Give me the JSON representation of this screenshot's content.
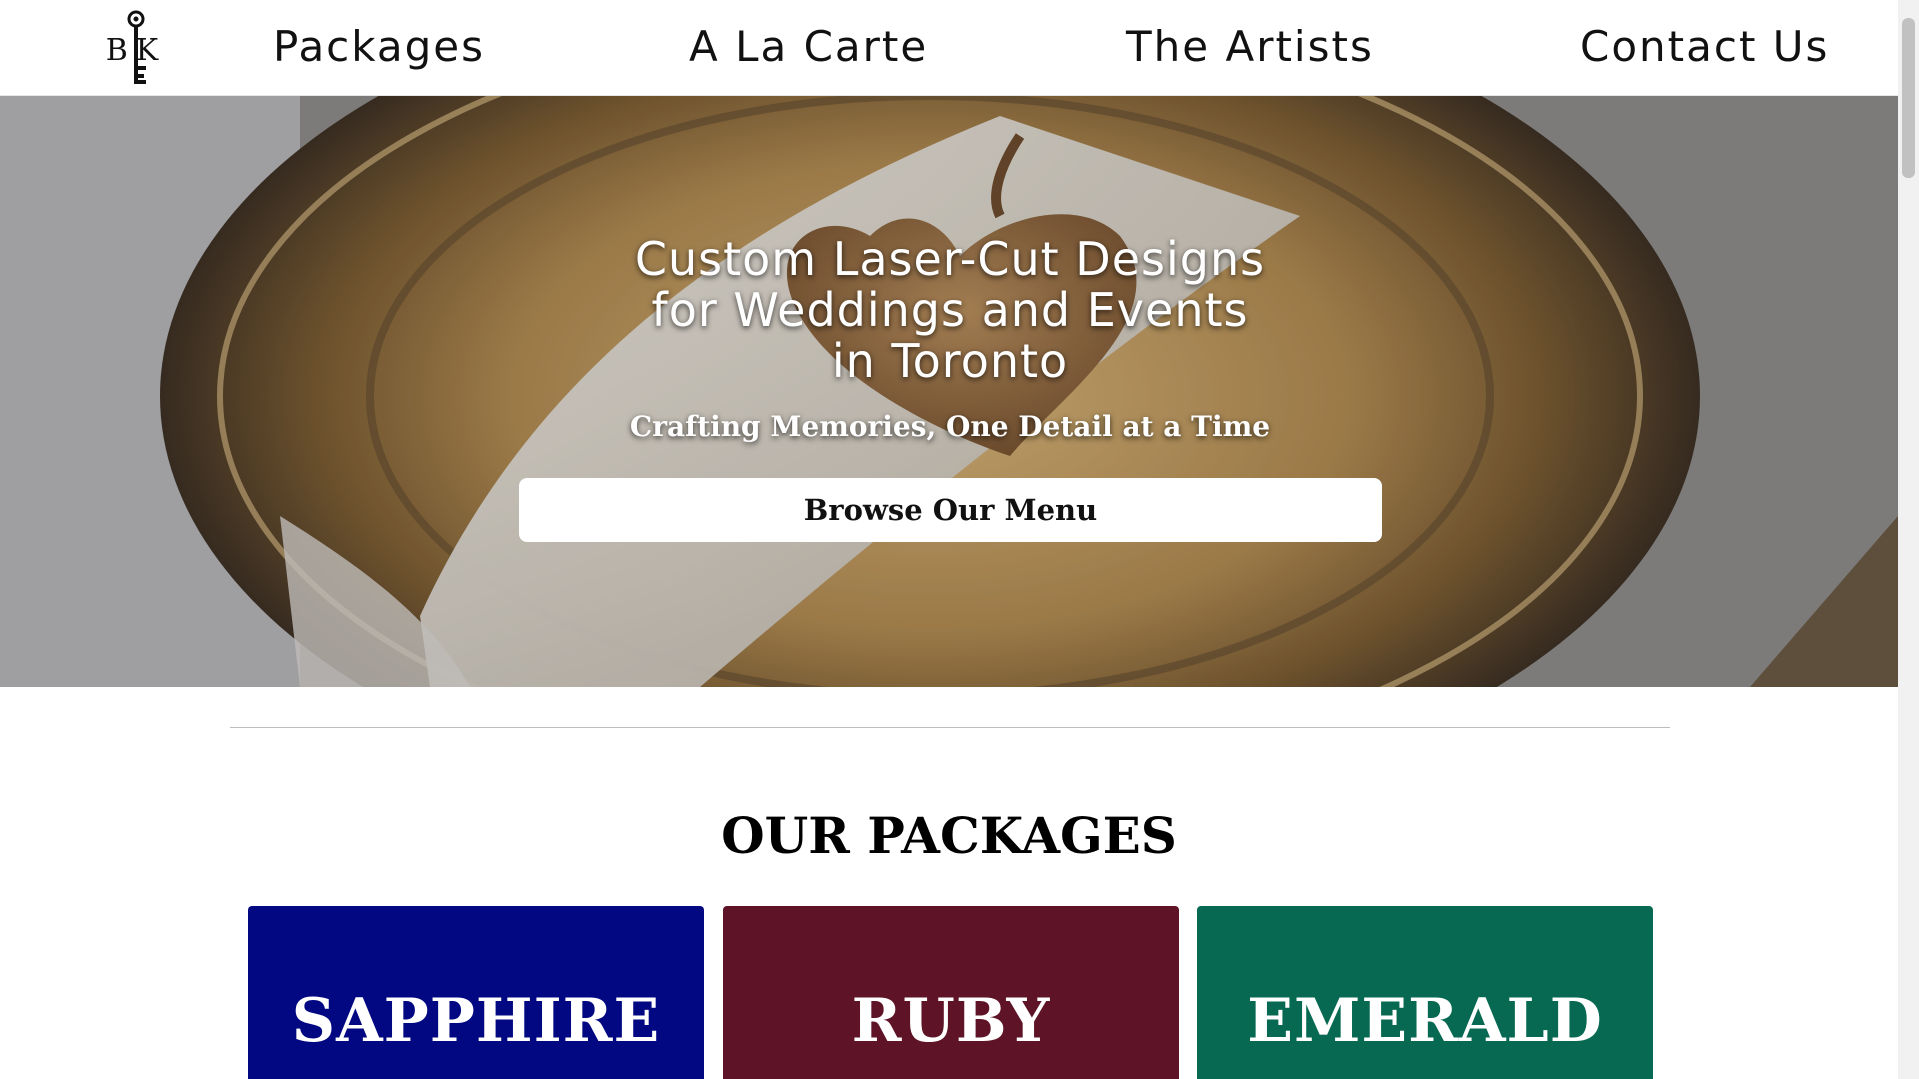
{
  "nav": {
    "logo_text": "BK",
    "items": [
      "Packages",
      "A La Carte",
      "The Artists",
      "Contact Us"
    ]
  },
  "hero": {
    "title_lines": [
      "Custom Laser-Cut Designs",
      "for Weddings and Events",
      "in Toronto"
    ],
    "subtitle": "Crafting Memories, One Detail at a Time",
    "button_label": "Browse Our Menu"
  },
  "packages": {
    "title": "OUR PACKAGES",
    "cards": [
      {
        "label": "SAPPHIRE",
        "color": "#020882"
      },
      {
        "label": "RUBY",
        "color": "#5e1426"
      },
      {
        "label": "EMERALD",
        "color": "#076952"
      }
    ]
  },
  "colors": {
    "sapphire": "#020882",
    "ruby": "#5e1426",
    "emerald": "#076952"
  }
}
